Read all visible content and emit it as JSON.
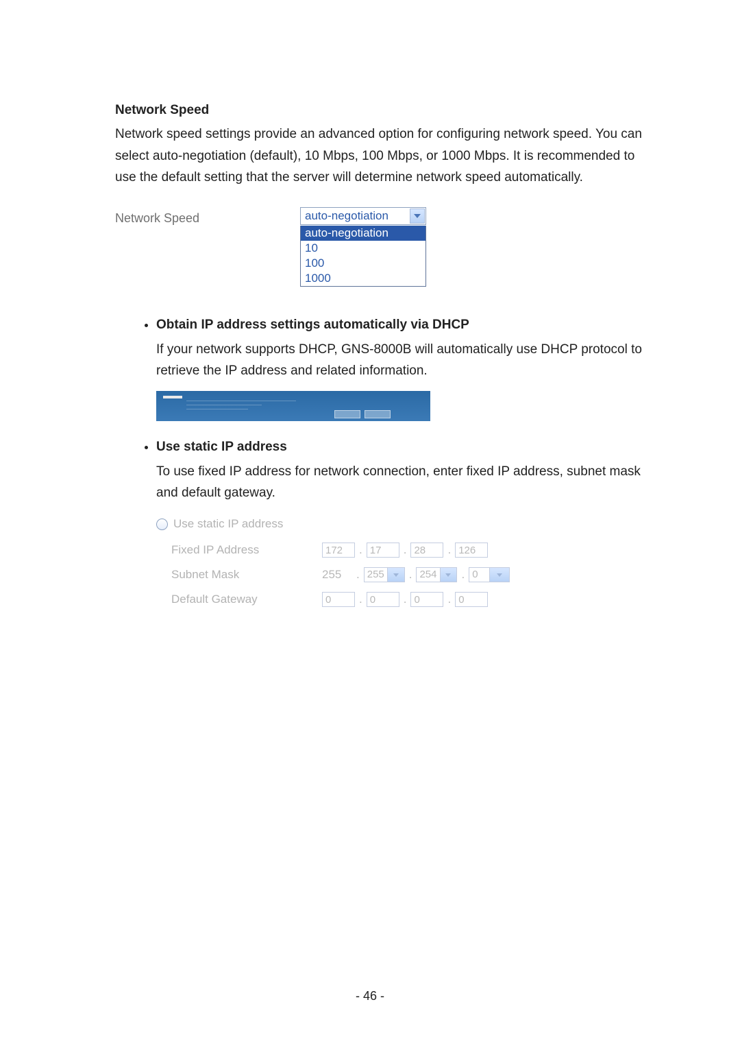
{
  "network_speed": {
    "heading": "Network Speed",
    "body": "Network speed settings provide an advanced option for configuring network speed. You can select auto-negotiation (default), 10 Mbps, 100 Mbps, or 1000 Mbps.  It is recommended to use the default setting that the server will determine network speed automatically.",
    "form_label": "Network Speed",
    "selected": "auto-negotiation",
    "options": [
      "auto-negotiation",
      "10",
      "100",
      "1000"
    ]
  },
  "dhcp": {
    "heading": "Obtain IP address settings automatically via DHCP",
    "body": "If your network supports DHCP, GNS-8000B will automatically use DHCP protocol to retrieve the IP address and related information."
  },
  "static_ip": {
    "heading": "Use static IP address",
    "body": "To use fixed IP address for network connection, enter fixed IP address, subnet mask and default gateway.",
    "radio_label": "Use static IP address",
    "rows": {
      "fixed_ip": {
        "label": "Fixed IP Address",
        "o1": "172",
        "o2": "17",
        "o3": "28",
        "o4": "126"
      },
      "subnet": {
        "label": "Subnet Mask",
        "prefix": "255",
        "o2": "255",
        "o3": "254",
        "o4": "0"
      },
      "gateway": {
        "label": "Default Gateway",
        "o1": "0",
        "o2": "0",
        "o3": "0",
        "o4": "0"
      }
    }
  },
  "page_number": "- 46 -",
  "icons": {
    "chevron_down": "chevron-down-icon",
    "radio_unchecked": "radio-unchecked-icon"
  }
}
